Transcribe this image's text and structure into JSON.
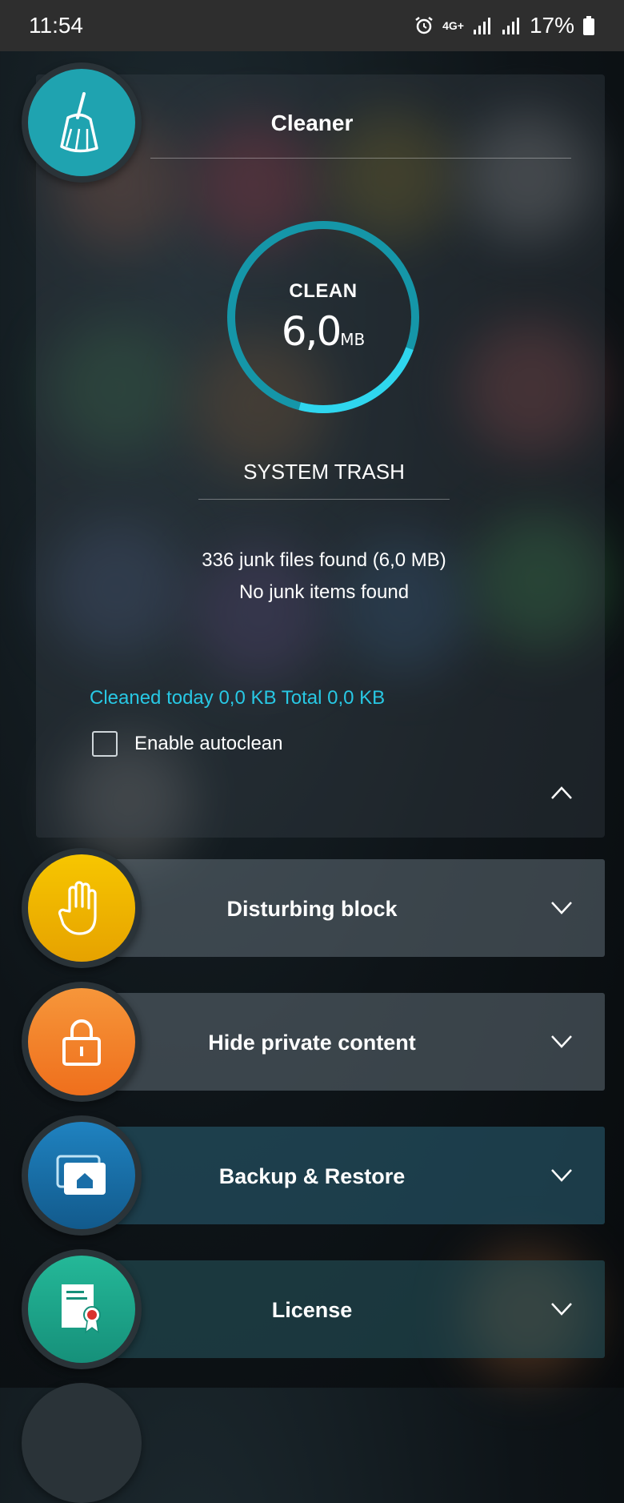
{
  "status_bar": {
    "time": "11:54",
    "network": "4G+",
    "battery": "17%"
  },
  "cleaner": {
    "title": "Cleaner",
    "ring_label": "CLEAN",
    "ring_value": "6,0",
    "ring_unit": "MB",
    "ring_progress": 1.0,
    "section_title": "SYSTEM TRASH",
    "info_line1": "336 junk files found (6,0 MB)",
    "info_line2": "No junk items found",
    "cleaned_text": "Cleaned today 0,0 KB Total 0,0 KB",
    "autoclean_label": "Enable autoclean",
    "autoclean_checked": false,
    "accent_color": "#1fb8cc"
  },
  "modules": [
    {
      "label": "Disturbing block",
      "icon": "hand-icon",
      "color": "#f5b400"
    },
    {
      "label": "Hide private content",
      "icon": "lock-icon",
      "color": "#f2812a"
    },
    {
      "label": "Backup & Restore",
      "icon": "backup-icon",
      "color": "#1a6ea8"
    },
    {
      "label": "License",
      "icon": "certificate-icon",
      "color": "#1fa88c"
    }
  ]
}
